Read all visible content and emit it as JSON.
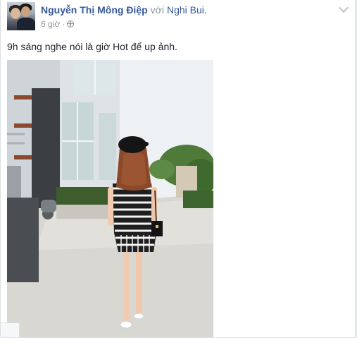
{
  "post": {
    "author": "Nguyễn Thị Mông Điệp",
    "with_text": "với",
    "tagged_user": "Nghi Bui.",
    "timestamp": "6 giờ",
    "separator": "·",
    "privacy_icon": "globe-icon",
    "menu_icon": "chevron-down-icon",
    "text": "9h sáng nghe nói là giờ Hot để up ảnh."
  },
  "colors": {
    "link": "#365899",
    "meta": "#90949c",
    "text": "#1d2129"
  }
}
